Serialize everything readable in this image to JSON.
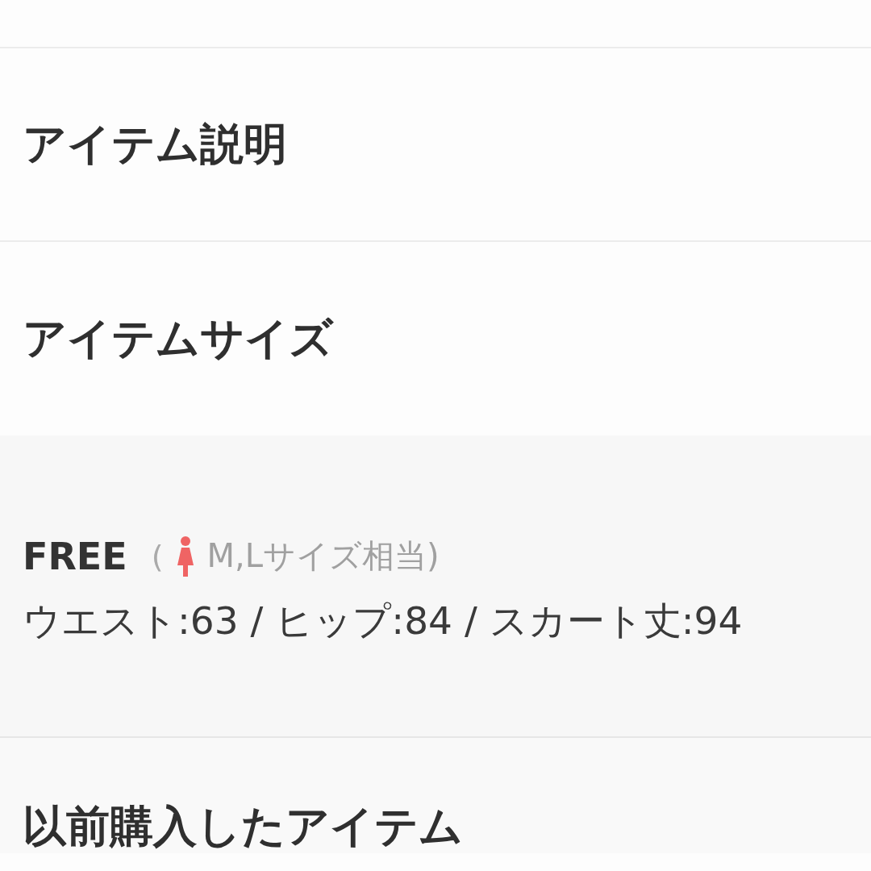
{
  "sections": [
    {
      "title": "アイテム説明"
    },
    {
      "title": "アイテムサイズ",
      "sizes": [
        {
          "label": "FREE",
          "note_open": "(",
          "note": "M,Lサイズ相当)",
          "measurements": "ウエスト:63 / ヒップ:84 / スカート丈:94"
        }
      ]
    },
    {
      "title": "以前購入したアイテム"
    }
  ]
}
